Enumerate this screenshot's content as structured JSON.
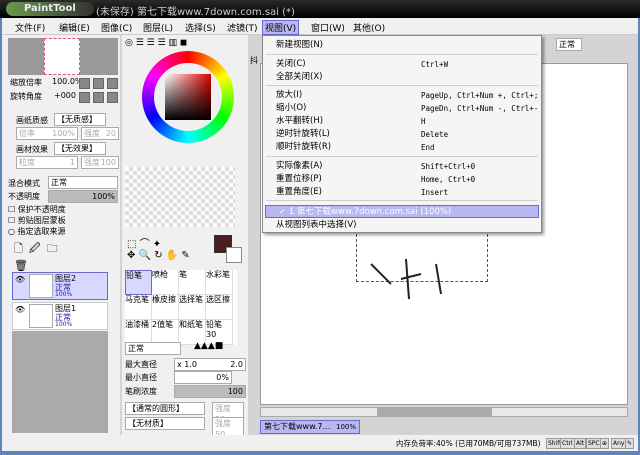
{
  "window": {
    "app": "PaintTool SAI",
    "title": "(未保存) 第七下载www.7down.com.sai (*)"
  },
  "menubar": [
    "文件(F)",
    "编辑(E)",
    "图像(C)",
    "图层(L)",
    "选择(S)",
    "滤镜(T)",
    "视图(V)",
    "窗口(W)",
    "其他(O)"
  ],
  "view_menu": {
    "items": [
      {
        "label": "新建视图(N)",
        "shortcut": ""
      },
      {
        "label": "关闭(C)",
        "shortcut": "Ctrl+W"
      },
      {
        "label": "全部关闭(X)",
        "shortcut": ""
      },
      {
        "label": "放大(I)",
        "shortcut": "PageUp, Ctrl+Num +, Ctrl+;"
      },
      {
        "label": "缩小(O)",
        "shortcut": "PageDn, Ctrl+Num -, Ctrl+-"
      },
      {
        "label": "水平翻转(H)",
        "shortcut": "H"
      },
      {
        "label": "逆时针旋转(L)",
        "shortcut": "Delete"
      },
      {
        "label": "顺时针旋转(R)",
        "shortcut": "End"
      },
      {
        "label": "实际像素(A)",
        "shortcut": "Shift+Ctrl+0"
      },
      {
        "label": "重置位移(P)",
        "shortcut": "Home, Ctrl+0"
      },
      {
        "label": "重置角度(E)",
        "shortcut": "Insert"
      },
      {
        "label": "✓ 1 第七下载www.7down.com.sai (100%)",
        "shortcut": ""
      },
      {
        "label": "从视图列表中选择(V)",
        "shortcut": ""
      }
    ]
  },
  "navigator": {
    "zoom_label": "缩放倍率",
    "zoom_value": "100.0%",
    "angle_label": "旋转角度",
    "angle_value": "+000"
  },
  "texture": {
    "paper_label": "画纸质感",
    "paper_value": "【无质感】",
    "scale_label": "倍率",
    "scale_value": "100%",
    "strength_label": "强度",
    "strength_value": "20",
    "effect_label": "画材效果",
    "effect_value": "【无效果】",
    "grain_label": "粒度",
    "grain_value": "1",
    "effect_strength_value": "100"
  },
  "layer_props": {
    "blend_label": "混合模式",
    "blend_value": "正常",
    "opacity_label": "不透明度",
    "opacity_value": "100%",
    "opacity": 100,
    "protect": "保护不透明度",
    "clip": "剪贴图层蒙板",
    "source": "指定选取来源"
  },
  "layers": [
    {
      "name": "图层2",
      "mode": "正常",
      "opacity": "100%",
      "selected": true
    },
    {
      "name": "图层1",
      "mode": "正常",
      "opacity": "100%",
      "selected": false
    }
  ],
  "tools": [
    "铅笔",
    "喷枪",
    "笔",
    "水彩笔",
    "马克笔",
    "橡皮擦",
    "选择笔",
    "选区擦",
    "油漆桶",
    "2值笔",
    "和纸笔",
    "铅笔30"
  ],
  "brush": {
    "mode": "正常",
    "max_label": "最大直径",
    "max_mult": "x 1.0",
    "max_value": "2.0",
    "min_label": "最小直径",
    "min_value": "0%",
    "density_label": "笔刷浓度",
    "density_value": "100",
    "shape": "【通常的圆形】",
    "shape_strength_label": "强度",
    "shape_strength": "50",
    "texture": "【无材质】",
    "texture_strength": "50"
  },
  "colors": {
    "primary": "#4a1e1e",
    "accent": "#b8b8f0"
  },
  "canvas": {
    "blend": "正常",
    "tab_label": "抖",
    "doc_tab": "第七下载www.7d...",
    "doc_zoom": "100%"
  },
  "status": {
    "memory": "内存负荷率:40% (已用70MB/可用737MB)",
    "keys": [
      "Shift",
      "Ctrl",
      "Alt",
      "SPC",
      "⊕",
      "Any",
      "✎"
    ]
  }
}
